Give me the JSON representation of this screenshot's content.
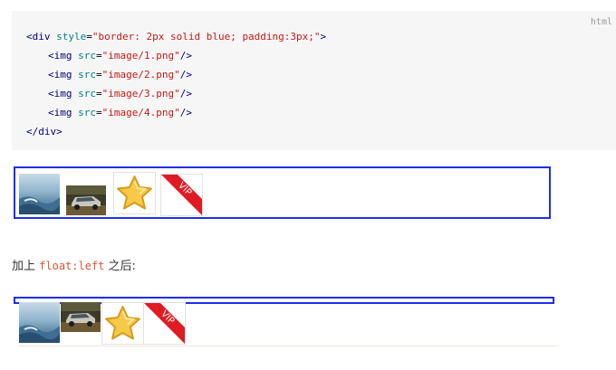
{
  "code": {
    "language": "html",
    "lines": [
      {
        "tag_open": "<div",
        "attr": " style",
        "eq": "=",
        "value": "\"border: 2px solid blue; padding:3px;\"",
        "tag_close": ">"
      },
      {
        "tag_open": "<img",
        "attr": " src",
        "eq": "=",
        "value": "\"image/1.png\"",
        "tag_close": "/>"
      },
      {
        "tag_open": "<img",
        "attr": " src",
        "eq": "=",
        "value": "\"image/2.png\"",
        "tag_close": "/>"
      },
      {
        "tag_open": "<img",
        "attr": " src",
        "eq": "=",
        "value": "\"image/3.png\"",
        "tag_close": "/>"
      },
      {
        "tag_open": "<img",
        "attr": " src",
        "eq": "=",
        "value": "\"image/4.png\"",
        "tag_close": "/>"
      },
      {
        "tag_open": "</div",
        "attr": "",
        "eq": "",
        "value": "",
        "tag_close": ">"
      }
    ]
  },
  "caption": {
    "prefix": "加上",
    "code": "float:left",
    "suffix": "之后:"
  },
  "vip_text": "VIP",
  "colors": {
    "border_blue": "#1f2ee8",
    "code_bg": "#f6f6f6",
    "inline_code": "#e0533a",
    "vip_red": "#e01b24"
  },
  "icons": [
    "sea-image-icon",
    "car-image-icon",
    "star-icon",
    "vip-ribbon-icon"
  ]
}
